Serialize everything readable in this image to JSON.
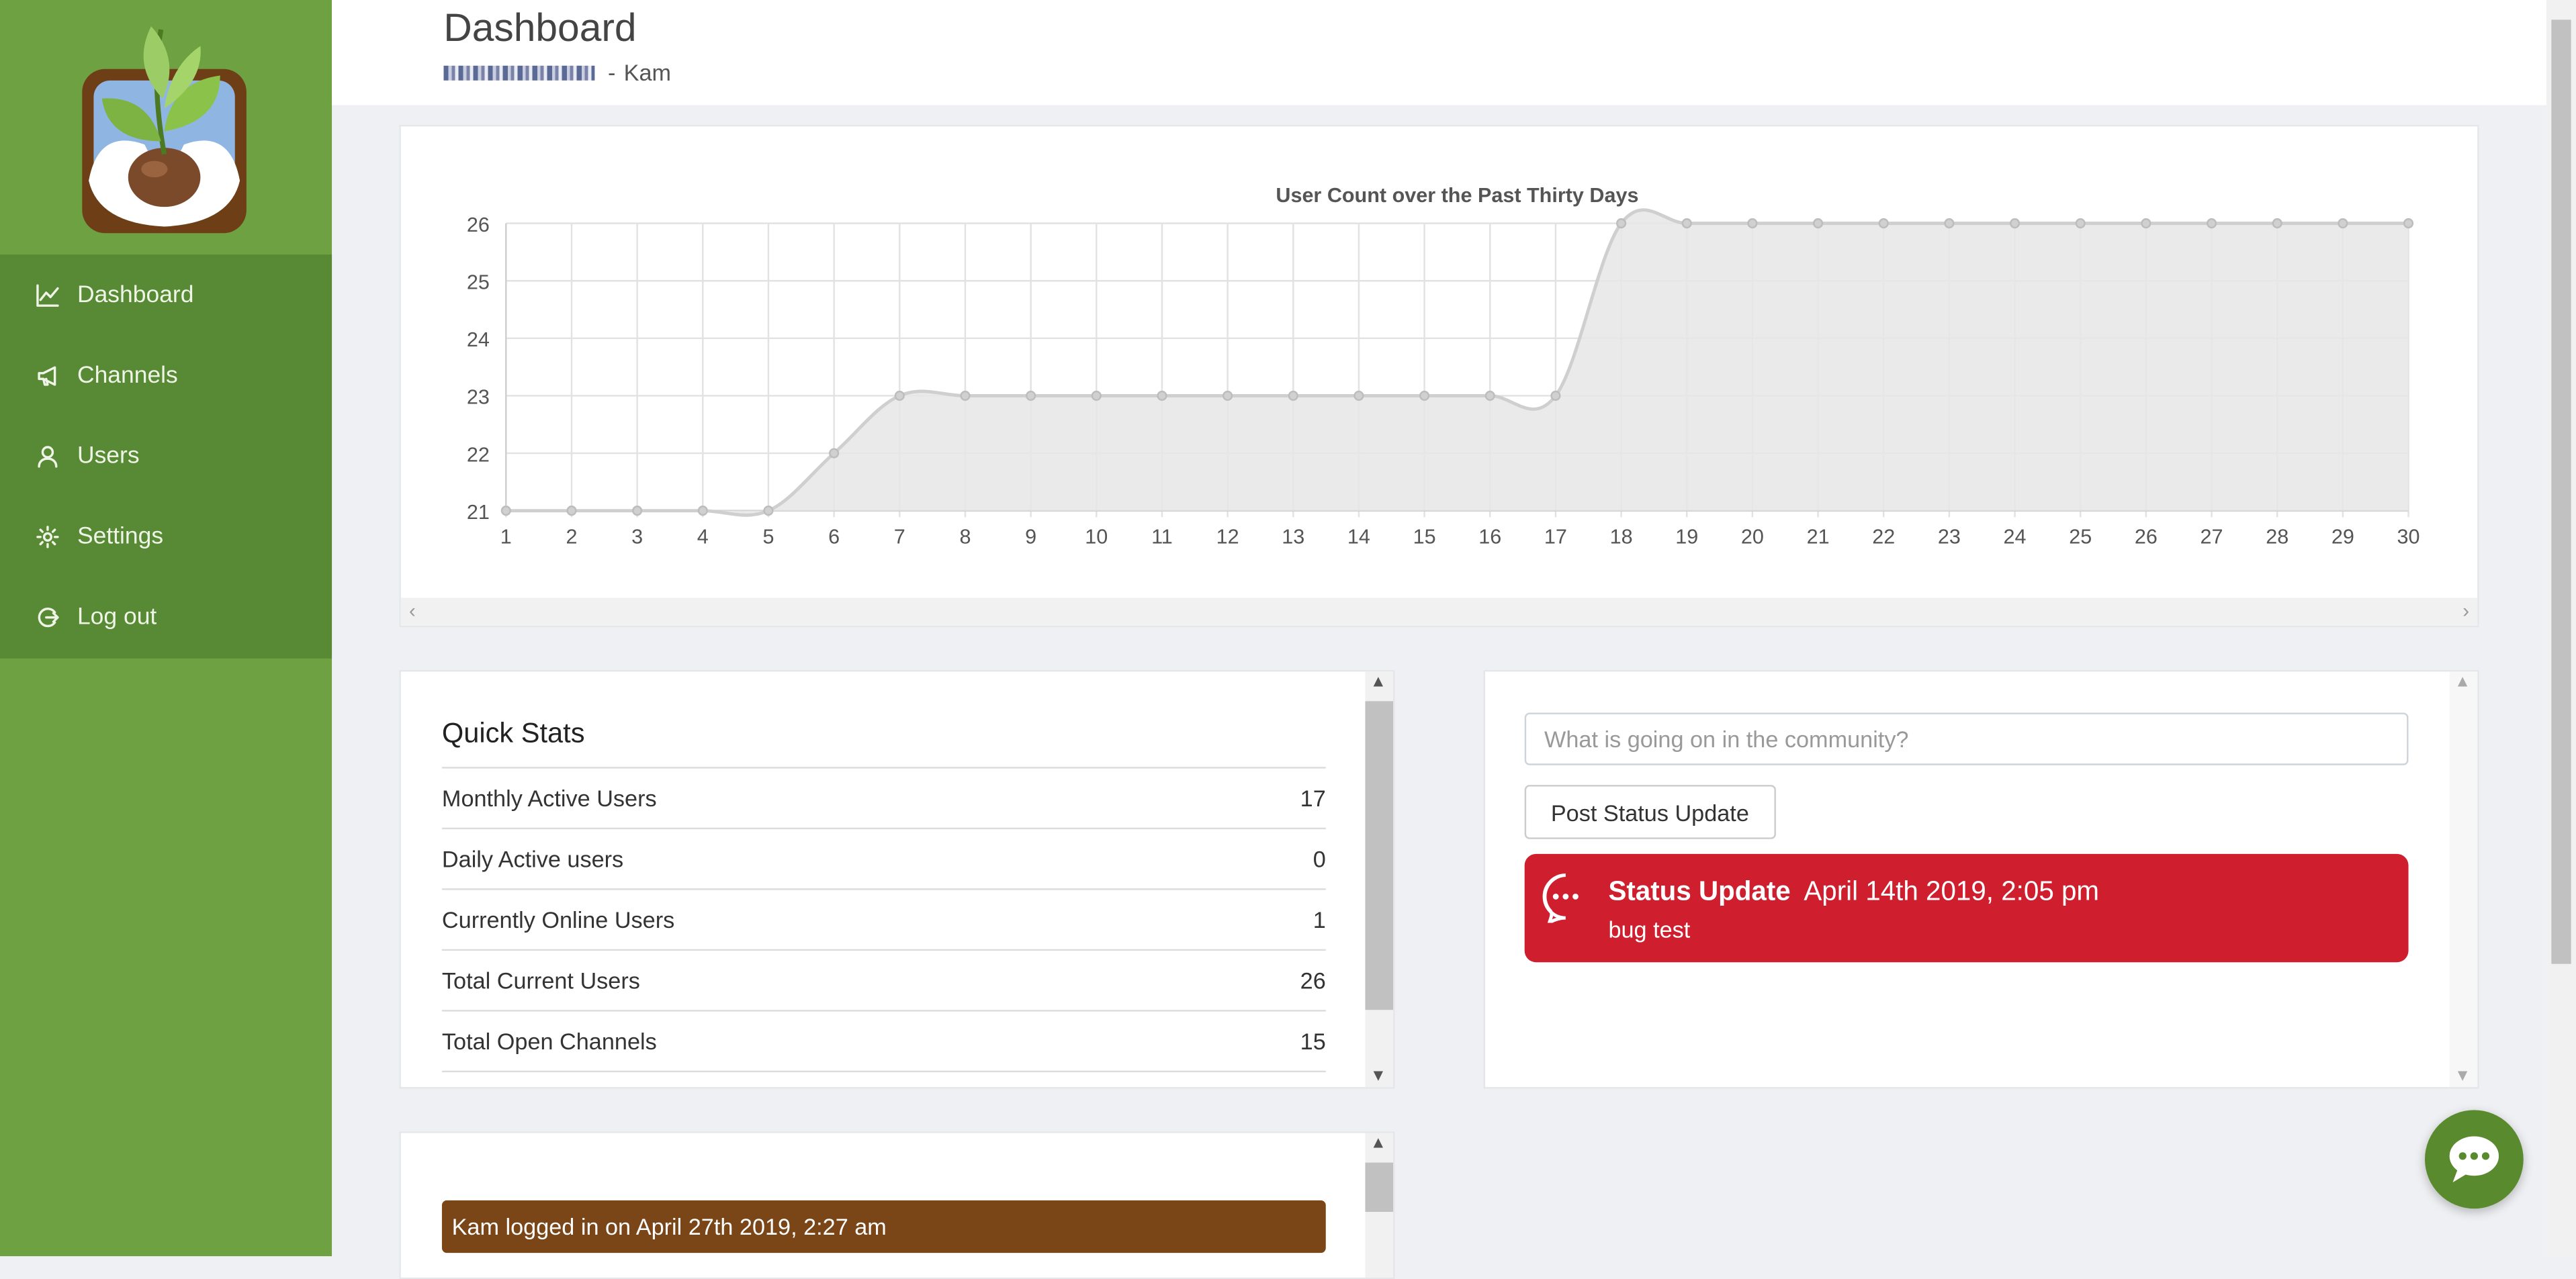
{
  "header": {
    "title": "Dashboard",
    "user_name": "Kam",
    "separator": "-"
  },
  "sidebar": {
    "items": [
      {
        "label": "Dashboard",
        "icon": "line-chart-icon"
      },
      {
        "label": "Channels",
        "icon": "megaphone-icon"
      },
      {
        "label": "Users",
        "icon": "user-icon"
      },
      {
        "label": "Settings",
        "icon": "gear-icon"
      },
      {
        "label": "Log out",
        "icon": "logout-icon"
      }
    ]
  },
  "chart_data": {
    "type": "area",
    "title": "User Count over the Past Thirty Days",
    "xlabel": "",
    "ylabel": "",
    "x": [
      1,
      2,
      3,
      4,
      5,
      6,
      7,
      8,
      9,
      10,
      11,
      12,
      13,
      14,
      15,
      16,
      17,
      18,
      19,
      20,
      21,
      22,
      23,
      24,
      25,
      26,
      27,
      28,
      29,
      30
    ],
    "values": [
      21,
      21,
      21,
      21,
      21,
      22,
      23,
      23,
      23,
      23,
      23,
      23,
      23,
      23,
      23,
      23,
      23,
      26,
      26,
      26,
      26,
      26,
      26,
      26,
      26,
      26,
      26,
      26,
      26,
      26
    ],
    "ylim": [
      21,
      26
    ],
    "yticks": [
      21,
      22,
      23,
      24,
      25,
      26
    ],
    "grid": true,
    "fill_color": "#e6e6e6",
    "line_color": "#cfcfcf"
  },
  "quick_stats": {
    "title": "Quick Stats",
    "rows": [
      {
        "label": "Monthly Active Users",
        "value": "17"
      },
      {
        "label": "Daily Active users",
        "value": "0"
      },
      {
        "label": "Currently Online Users",
        "value": "1"
      },
      {
        "label": "Total Current Users",
        "value": "26"
      },
      {
        "label": "Total Open Channels",
        "value": "15"
      }
    ]
  },
  "status": {
    "placeholder": "What is going on in the community?",
    "post_button": "Post Status Update",
    "update": {
      "label": "Status Update",
      "date": "April 14th 2019, 2:05 pm",
      "body": "bug test"
    }
  },
  "activity": {
    "entries": [
      "Kam logged in on April 27th 2019, 2:27 am"
    ]
  },
  "colors": {
    "sidebar": "#6ea142",
    "nav": "#588a35",
    "status_update": "#cf1f2e",
    "log_entry": "#7a4517",
    "chat_button": "#5a8a2e"
  }
}
